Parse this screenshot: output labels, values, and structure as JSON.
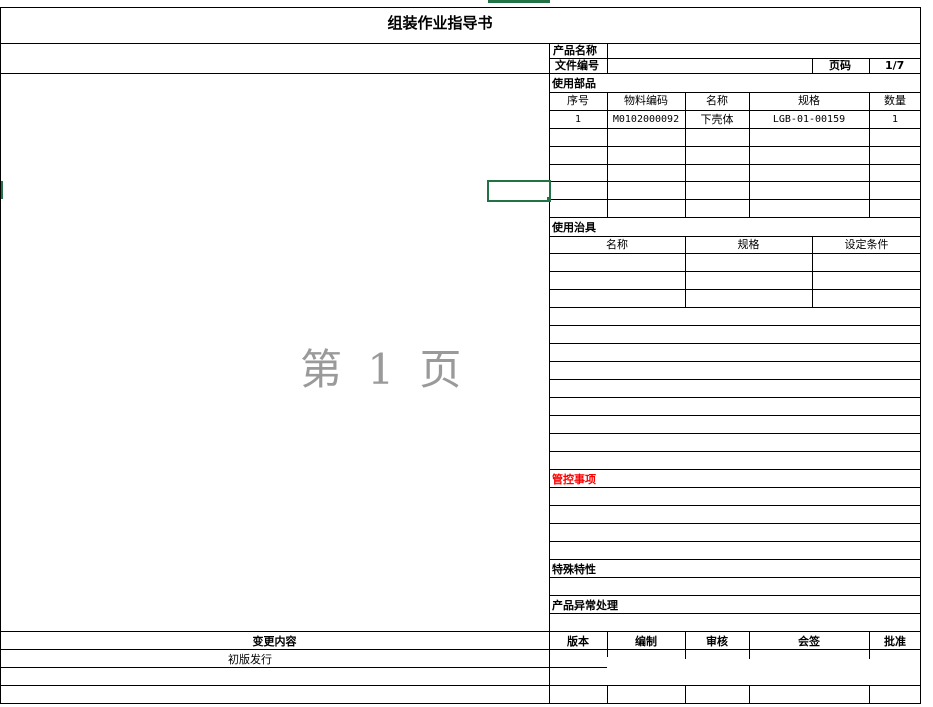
{
  "doc": {
    "title": "组装作业指导书",
    "product_name_label": "产品名称",
    "doc_no_label": "文件编号",
    "page_label": "页码",
    "page_value": "1/7",
    "watermark": "第 1 页"
  },
  "parts": {
    "section_label": "使用部品",
    "headers": [
      "序号",
      "物料编码",
      "名称",
      "规格",
      "数量"
    ],
    "rows": [
      {
        "no": "1",
        "code": "M0102000092",
        "name": "下壳体",
        "spec": "LGB-01-00159",
        "qty": "1"
      }
    ]
  },
  "fixtures": {
    "section_label": "使用治具",
    "headers": [
      "名称",
      "规格",
      "设定条件"
    ]
  },
  "control": {
    "label": "管控事项",
    "color": "#ff0000"
  },
  "special": {
    "label": "特殊特性"
  },
  "abnormal": {
    "label": "产品异常处理"
  },
  "footer": {
    "headers": [
      "变更内容",
      "版本",
      "编制",
      "审核",
      "会签",
      "批准"
    ],
    "rows": [
      {
        "change": "初版发行"
      }
    ]
  },
  "colors": {
    "excel_green": "#217346",
    "watermark_gray": "#9a9a9a"
  }
}
